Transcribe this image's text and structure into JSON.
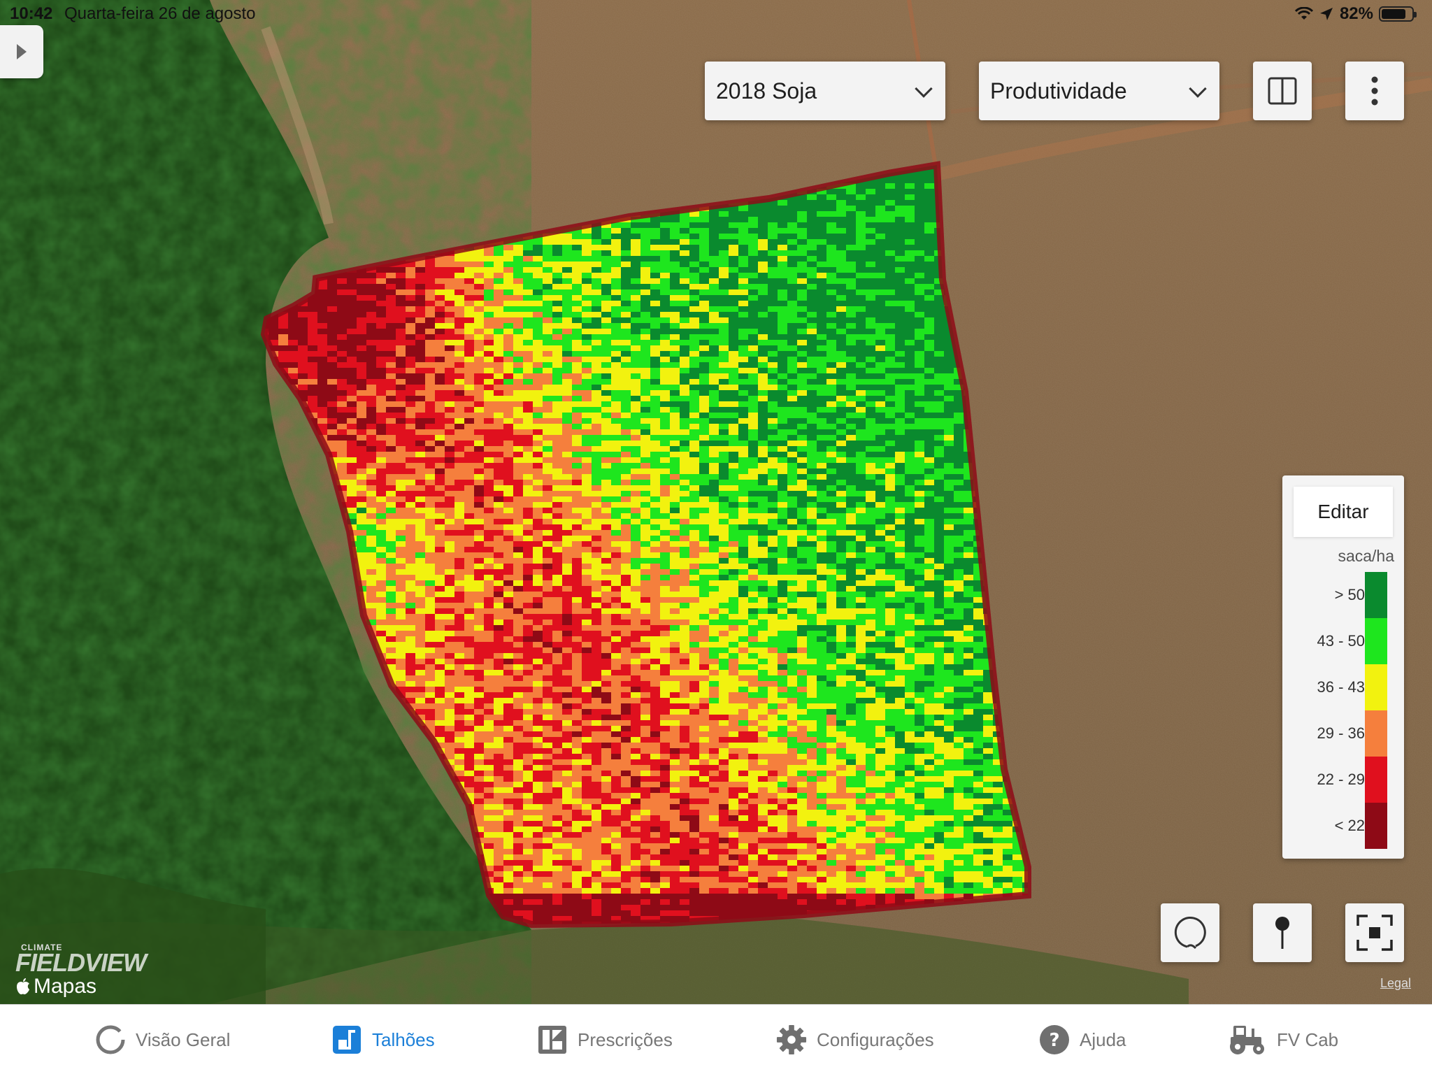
{
  "status_bar": {
    "time": "10:42",
    "date": "Quarta-feira 26 de agosto",
    "battery": "82%",
    "battery_level": 0.82,
    "icons": [
      "wifi-icon",
      "location-arrow-icon",
      "battery-icon"
    ]
  },
  "toolbar": {
    "season_select": "2018 Soja",
    "layer_select": "Produtividade",
    "split_view_icon": "split-view-icon",
    "more_icon": "more-vertical-icon"
  },
  "legend": {
    "edit_label": "Editar",
    "unit": "saca/ha",
    "items": [
      {
        "label": "> 50",
        "color": "#0a8a2e"
      },
      {
        "label": "43 - 50",
        "color": "#1ee61e"
      },
      {
        "label": "36 - 43",
        "color": "#f2f20f"
      },
      {
        "label": "29 - 36",
        "color": "#f57f3d"
      },
      {
        "label": "22 - 29",
        "color": "#e0101e"
      },
      {
        "label": "< 22",
        "color": "#8e0a16"
      }
    ]
  },
  "map_controls": {
    "lasso_icon": "lasso-icon",
    "pin_icon": "map-pin-icon",
    "fit_icon": "fit-bounds-icon"
  },
  "branding": {
    "climate": "CLIMATE",
    "fieldview": "FIELDVIEW",
    "maps": "Mapas",
    "legal": "Legal"
  },
  "tabs": [
    {
      "label": "Visão Geral",
      "icon": "overview-ring-icon",
      "active": false
    },
    {
      "label": "Talhões",
      "icon": "fields-icon",
      "active": true
    },
    {
      "label": "Prescrições",
      "icon": "prescriptions-icon",
      "active": false
    },
    {
      "label": "Configurações",
      "icon": "gear-icon",
      "active": false
    },
    {
      "label": "Ajuda",
      "icon": "help-icon",
      "active": false
    },
    {
      "label": "FV Cab",
      "icon": "tractor-icon",
      "active": false
    }
  ],
  "colors": {
    "accent": "#1b7fd8",
    "tab_inactive": "#777777"
  }
}
